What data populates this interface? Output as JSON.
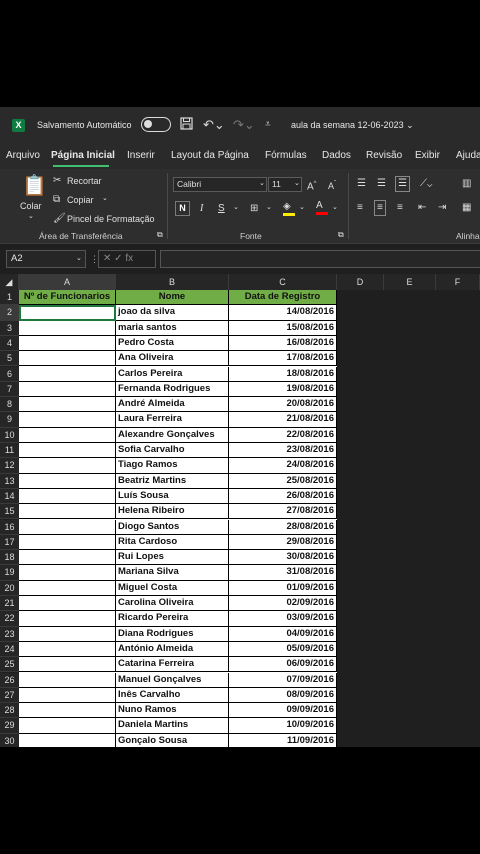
{
  "titlebar": {
    "logo_text": "X",
    "autosave_label": "Salvamento Automático",
    "doc_title": "aula da semana  12-06-2023 ⌄"
  },
  "menu": {
    "tabs": [
      "Arquivo",
      "Página Inicial",
      "Inserir",
      "Layout da Página",
      "Fórmulas",
      "Dados",
      "Revisão",
      "Exibir",
      "Ajuda"
    ]
  },
  "ribbon": {
    "paste_label": "Colar",
    "cut_label": "Recortar",
    "copy_label": "Copiar",
    "format_painter_label": "Pincel de Formatação",
    "clipboard_group": "Área de Transferência",
    "font_name": "Calibri",
    "font_size": "11",
    "bold": "N",
    "italic": "I",
    "underline": "S",
    "font_group": "Fonte",
    "align_group": "Alinha"
  },
  "formula_bar": {
    "name_box": "A2",
    "fx_symbols": "✕  ✓  fx",
    "formula": ""
  },
  "grid": {
    "columns": [
      "A",
      "B",
      "C",
      "D",
      "E",
      "F"
    ],
    "headers": [
      "Nº de Funcionarios",
      "Nome",
      "Data de Registro"
    ],
    "rows": [
      [
        "",
        "joao da silva",
        "14/08/2016"
      ],
      [
        "",
        "maria santos",
        "15/08/2016"
      ],
      [
        "",
        "Pedro Costa",
        "16/08/2016"
      ],
      [
        "",
        "Ana Oliveira",
        "17/08/2016"
      ],
      [
        "",
        "Carlos Pereira",
        "18/08/2016"
      ],
      [
        "",
        "Fernanda Rodrigues",
        "19/08/2016"
      ],
      [
        "",
        "André Almeida",
        "20/08/2016"
      ],
      [
        "",
        "Laura Ferreira",
        "21/08/2016"
      ],
      [
        "",
        "Alexandre Gonçalves",
        "22/08/2016"
      ],
      [
        "",
        "Sofia Carvalho",
        "23/08/2016"
      ],
      [
        "",
        "Tiago Ramos",
        "24/08/2016"
      ],
      [
        "",
        "Beatriz Martins",
        "25/08/2016"
      ],
      [
        "",
        "Luís Sousa",
        "26/08/2016"
      ],
      [
        "",
        "Helena Ribeiro",
        "27/08/2016"
      ],
      [
        "",
        "Diogo Santos",
        "28/08/2016"
      ],
      [
        "",
        "Rita Cardoso",
        "29/08/2016"
      ],
      [
        "",
        "Rui Lopes",
        "30/08/2016"
      ],
      [
        "",
        "Mariana Silva",
        "31/08/2016"
      ],
      [
        "",
        "Miguel Costa",
        "01/09/2016"
      ],
      [
        "",
        "Carolina Oliveira",
        "02/09/2016"
      ],
      [
        "",
        "Ricardo Pereira",
        "03/09/2016"
      ],
      [
        "",
        "Diana Rodrigues",
        "04/09/2016"
      ],
      [
        "",
        "António Almeida",
        "05/09/2016"
      ],
      [
        "",
        "Catarina Ferreira",
        "06/09/2016"
      ],
      [
        "",
        "Manuel Gonçalves",
        "07/09/2016"
      ],
      [
        "",
        "Inês Carvalho",
        "08/09/2016"
      ],
      [
        "",
        "Nuno Ramos",
        "09/09/2016"
      ],
      [
        "",
        "Daniela Martins",
        "10/09/2016"
      ],
      [
        "",
        "Gonçalo Sousa",
        "11/09/2016"
      ]
    ],
    "header_color": "#70ad47"
  }
}
